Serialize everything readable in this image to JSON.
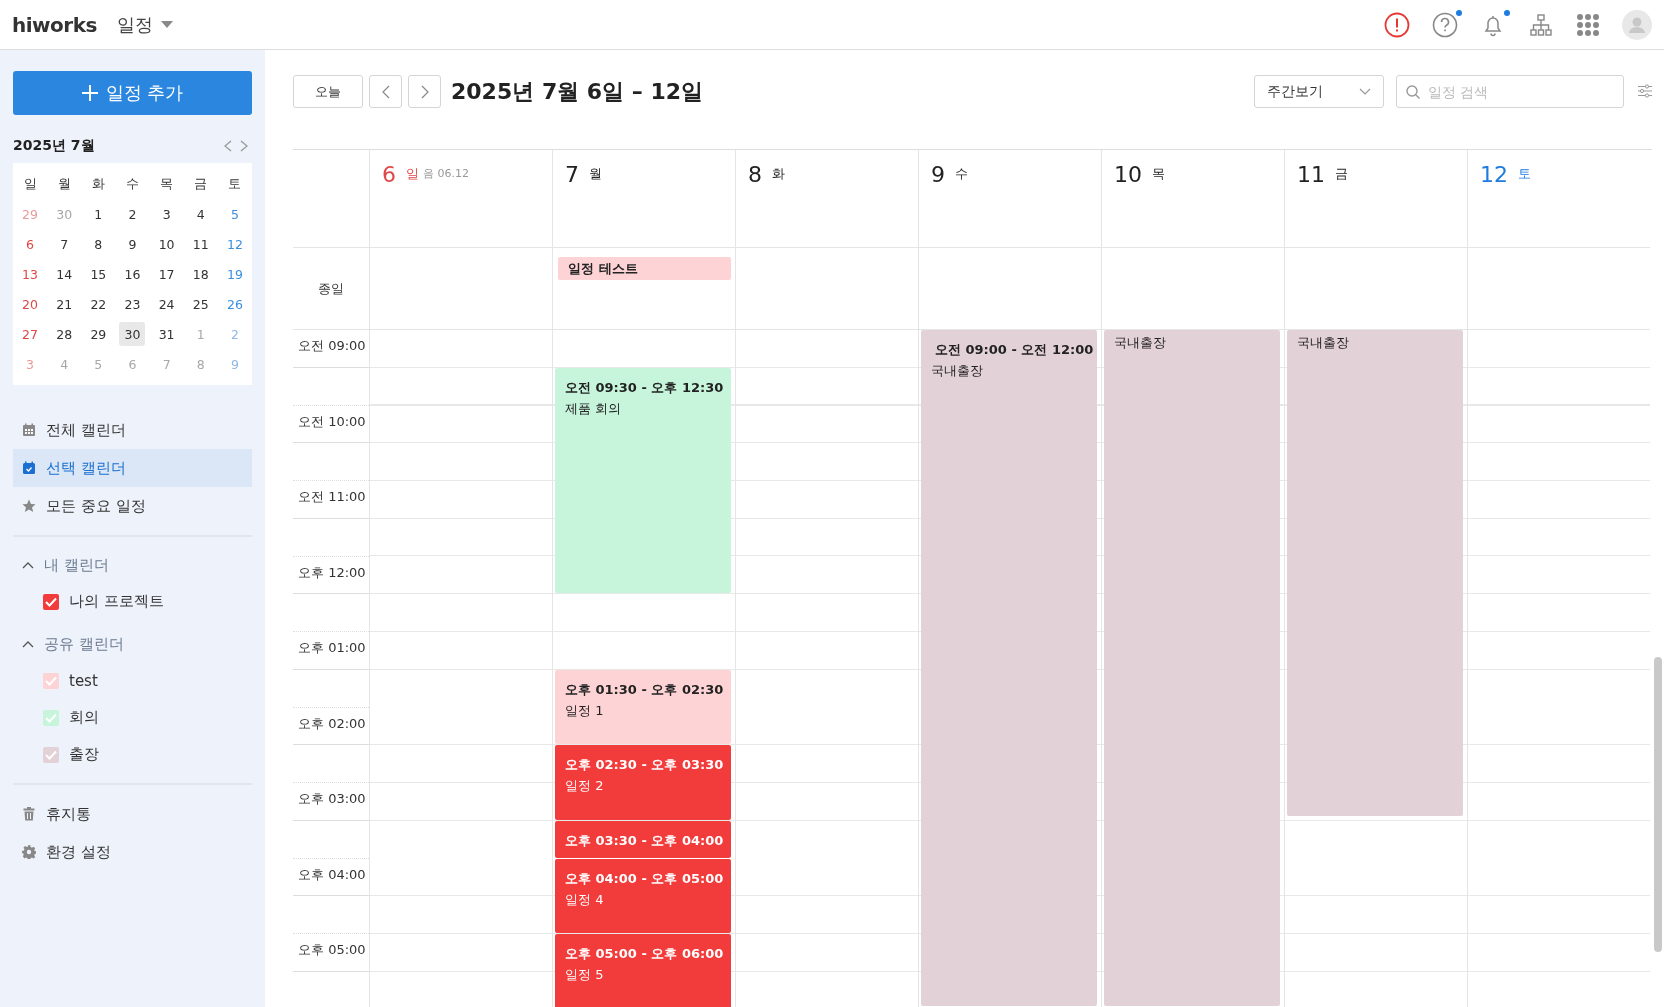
{
  "app": {
    "logo": "hiworks",
    "menu": "일정"
  },
  "top_icons": [
    {
      "kind": "alert",
      "dot": false
    },
    {
      "kind": "help",
      "dot": true
    },
    {
      "kind": "bell",
      "dot": true
    },
    {
      "kind": "org",
      "dot": false
    },
    {
      "kind": "apps",
      "dot": false
    },
    {
      "kind": "avatar",
      "dot": false
    }
  ],
  "sidebar": {
    "add_button": "일정 추가",
    "mini_calendar": {
      "title": "2025년 7월",
      "weekdays": [
        "일",
        "월",
        "화",
        "수",
        "목",
        "금",
        "토"
      ],
      "weeks": [
        [
          {
            "label": "29",
            "muted": true,
            "selected": false
          },
          {
            "label": "30",
            "muted": true,
            "selected": false
          },
          {
            "label": "1",
            "muted": false,
            "selected": false
          },
          {
            "label": "2",
            "muted": false,
            "selected": false
          },
          {
            "label": "3",
            "muted": false,
            "selected": false
          },
          {
            "label": "4",
            "muted": false,
            "selected": false
          },
          {
            "label": "5",
            "muted": false,
            "selected": false
          }
        ],
        [
          {
            "label": "6",
            "muted": false,
            "selected": false
          },
          {
            "label": "7",
            "muted": false,
            "selected": false
          },
          {
            "label": "8",
            "muted": false,
            "selected": false
          },
          {
            "label": "9",
            "muted": false,
            "selected": false
          },
          {
            "label": "10",
            "muted": false,
            "selected": false
          },
          {
            "label": "11",
            "muted": false,
            "selected": false
          },
          {
            "label": "12",
            "muted": false,
            "selected": false
          }
        ],
        [
          {
            "label": "13",
            "muted": false,
            "selected": false
          },
          {
            "label": "14",
            "muted": false,
            "selected": false
          },
          {
            "label": "15",
            "muted": false,
            "selected": false
          },
          {
            "label": "16",
            "muted": false,
            "selected": false
          },
          {
            "label": "17",
            "muted": false,
            "selected": false
          },
          {
            "label": "18",
            "muted": false,
            "selected": false
          },
          {
            "label": "19",
            "muted": false,
            "selected": false
          }
        ],
        [
          {
            "label": "20",
            "muted": false,
            "selected": false
          },
          {
            "label": "21",
            "muted": false,
            "selected": false
          },
          {
            "label": "22",
            "muted": false,
            "selected": false
          },
          {
            "label": "23",
            "muted": false,
            "selected": false
          },
          {
            "label": "24",
            "muted": false,
            "selected": false
          },
          {
            "label": "25",
            "muted": false,
            "selected": false
          },
          {
            "label": "26",
            "muted": false,
            "selected": false
          }
        ],
        [
          {
            "label": "27",
            "muted": false,
            "selected": false
          },
          {
            "label": "28",
            "muted": false,
            "selected": false
          },
          {
            "label": "29",
            "muted": false,
            "selected": false
          },
          {
            "label": "30",
            "muted": false,
            "selected": true
          },
          {
            "label": "31",
            "muted": false,
            "selected": false
          },
          {
            "label": "1",
            "muted": true,
            "selected": false
          },
          {
            "label": "2",
            "muted": true,
            "selected": false
          }
        ],
        [
          {
            "label": "3",
            "muted": true,
            "selected": false
          },
          {
            "label": "4",
            "muted": true,
            "selected": false
          },
          {
            "label": "5",
            "muted": true,
            "selected": false
          },
          {
            "label": "6",
            "muted": true,
            "selected": false
          },
          {
            "label": "7",
            "muted": true,
            "selected": false
          },
          {
            "label": "8",
            "muted": true,
            "selected": false
          },
          {
            "label": "9",
            "muted": true,
            "selected": false
          }
        ]
      ]
    },
    "nav": [
      {
        "kind": "calendar",
        "label": "전체 캘린더",
        "selected": false
      },
      {
        "kind": "calendar-check",
        "label": "선택 캘린더",
        "selected": true
      },
      {
        "kind": "star",
        "label": "모든 중요 일정",
        "selected": false
      }
    ],
    "groups": [
      {
        "title": "내 캘린더",
        "expanded": true,
        "calendars": [
          {
            "name": "나의 프로젝트",
            "color": "#f23b3b",
            "checked": true
          }
        ]
      },
      {
        "title": "공유 캘린더",
        "expanded": true,
        "calendars": [
          {
            "name": "test",
            "color": "#fdd3d5",
            "checked": true
          },
          {
            "name": "회의",
            "color": "#c6f5dc",
            "checked": true
          },
          {
            "name": "출장",
            "color": "#e3d1d8",
            "checked": true
          }
        ]
      }
    ],
    "footer": [
      {
        "kind": "trash",
        "label": "휴지통"
      },
      {
        "kind": "gear",
        "label": "환경 설정"
      }
    ]
  },
  "toolbar": {
    "today": "오늘",
    "title": "2025년 7월 6일 – 12일",
    "view": "주간보기",
    "search": {
      "placeholder": "일정 검색"
    }
  },
  "week": {
    "all_day_label": "종일",
    "time_labels": [
      "오전 09:00",
      "오전 10:00",
      "오전 11:00",
      "오후 12:00",
      "오후 01:00",
      "오후 02:00",
      "오후 03:00",
      "오후 04:00",
      "오후 05:00"
    ],
    "days": [
      {
        "number": "6",
        "weekday": "일",
        "lunar": "음 06.12"
      },
      {
        "number": "7",
        "weekday": "월",
        "all_day": [
          {
            "title": "일정 테스트",
            "color": "#fdd3d5"
          }
        ],
        "events": [
          {
            "time": "오전 09:30 - 오후 12:30",
            "title": "제품 회의",
            "color": "#c6f5dc",
            "important": false
          },
          {
            "time": "오후 01:30 - 오후 02:30",
            "title": "일정 1",
            "color": "#fdd3d5",
            "important": false
          },
          {
            "time": "오후 02:30 - 오후 03:30",
            "title": "일정 2",
            "color": "#f23b3b",
            "important": false
          },
          {
            "time": "오후 03:30 - 오후 04:00",
            "color": "#f23b3b",
            "important": false
          },
          {
            "time": "오후 04:00 - 오후 05:00",
            "title": "일정 4",
            "color": "#f23b3b",
            "important": false
          },
          {
            "time": "오후 05:00 - 오후 06:00",
            "title": "일정 5",
            "color": "#f23b3b",
            "important": false
          }
        ]
      },
      {
        "number": "8",
        "weekday": "화"
      },
      {
        "number": "9",
        "weekday": "수",
        "events": [
          {
            "time": "오전 09:00 - 오전 12:00",
            "title": "국내출장",
            "color": "#e3d1d8",
            "important": true,
            "level": 1
          }
        ]
      },
      {
        "number": "10",
        "weekday": "목",
        "events": [
          {
            "title": "국내출장",
            "color": "#e3d1d8",
            "important": false,
            "level": 1
          }
        ]
      },
      {
        "number": "11",
        "weekday": "금",
        "events": [
          {
            "title": "국내출장",
            "color": "#e3d1d8",
            "important": false,
            "level": 0.72
          }
        ]
      },
      {
        "number": "12",
        "weekday": "토"
      }
    ]
  }
}
